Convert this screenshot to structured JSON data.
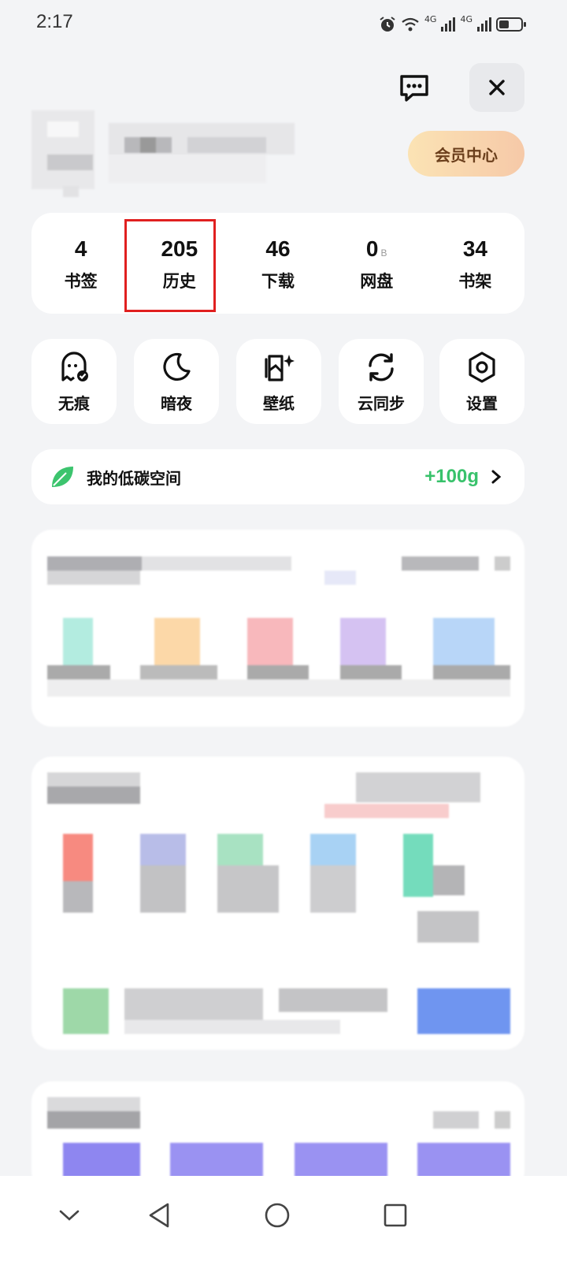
{
  "status_bar": {
    "time": "2:17",
    "network_1": "4G",
    "network_2": "4G"
  },
  "header": {
    "message_icon": "message-icon",
    "close_icon": "close-icon",
    "vip_label": "会员中心"
  },
  "stats": [
    {
      "value": "4",
      "label": "书签"
    },
    {
      "value": "205",
      "label": "历史"
    },
    {
      "value": "46",
      "label": "下载"
    },
    {
      "value": "0",
      "unit": "B",
      "label": "网盘"
    },
    {
      "value": "34",
      "label": "书架"
    }
  ],
  "tools": [
    {
      "icon": "incognito-ghost-icon",
      "label": "无痕"
    },
    {
      "icon": "moon-icon",
      "label": "暗夜"
    },
    {
      "icon": "wallpaper-icon",
      "label": "壁纸"
    },
    {
      "icon": "sync-icon",
      "label": "云同步"
    },
    {
      "icon": "settings-hexagon-icon",
      "label": "设置"
    }
  ],
  "carbon": {
    "icon": "leaf-icon",
    "title": "我的低碳空间",
    "value": "+100g",
    "accent": "#38c26b"
  },
  "colors": {
    "highlight_box": "#e02020",
    "vip_gradient_start": "#fbe3b4",
    "vip_gradient_end": "#f6c9a8"
  },
  "bottom_nav": [
    "collapse-chevron-icon",
    "back-icon",
    "home-icon",
    "recents-icon"
  ]
}
